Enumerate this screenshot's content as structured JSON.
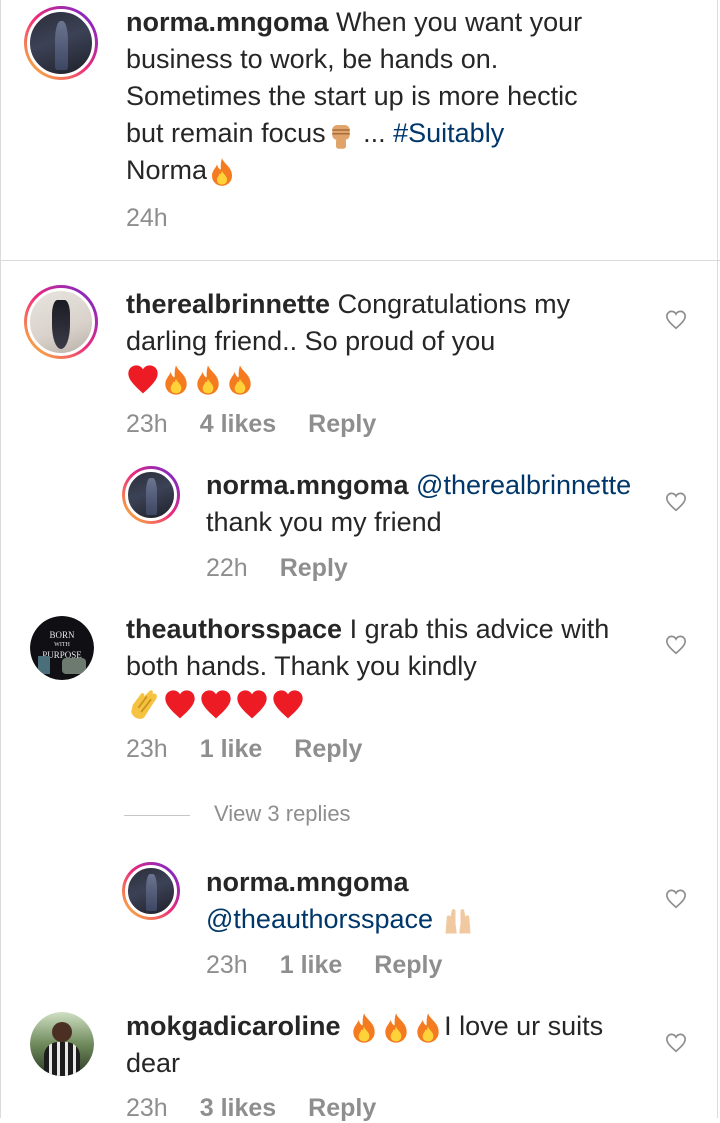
{
  "comments": [
    {
      "user": "norma.mngoma",
      "text_lines": [
        "When you want your",
        "business to work, be hands on.",
        "Sometimes the start up is more hectic",
        "but remain focus"
      ],
      "text_tail": " ... ",
      "hashtag": "#Suitably",
      "last_line": "Norma",
      "time": "24h"
    },
    {
      "user": "therealbrinnette",
      "text_line1": "Congratulations my",
      "text_line2": "darling friend.. So proud of you",
      "time": "23h",
      "likes": "4 likes",
      "reply": "Reply"
    },
    {
      "user": "norma.mngoma",
      "mention": "@therealbrinnette",
      "text": "thank you my friend",
      "time": "22h",
      "reply": "Reply"
    },
    {
      "user": "theauthorsspace",
      "text_line1": "I grab this advice with",
      "text_line2": "both hands. Thank you kindly",
      "time": "23h",
      "likes": "1 like",
      "reply": "Reply",
      "avatar_text": [
        "BORN",
        "WITH",
        "PURPOSE"
      ]
    },
    {
      "user": "norma.mngoma",
      "mention": "@theauthorsspace",
      "time": "23h",
      "likes": "1 like",
      "reply": "Reply"
    },
    {
      "user": "mokgadicaroline",
      "text_line1": "I love ur suits",
      "text_line2": "dear",
      "time": "23h",
      "likes": "3 likes",
      "reply": "Reply"
    }
  ],
  "view_replies": "View 3 replies",
  "colors": {
    "text": "#262626",
    "meta": "#8e8e8e",
    "link": "#00376b",
    "heart_red": "#ed1c24",
    "fire": "#f47b20"
  }
}
